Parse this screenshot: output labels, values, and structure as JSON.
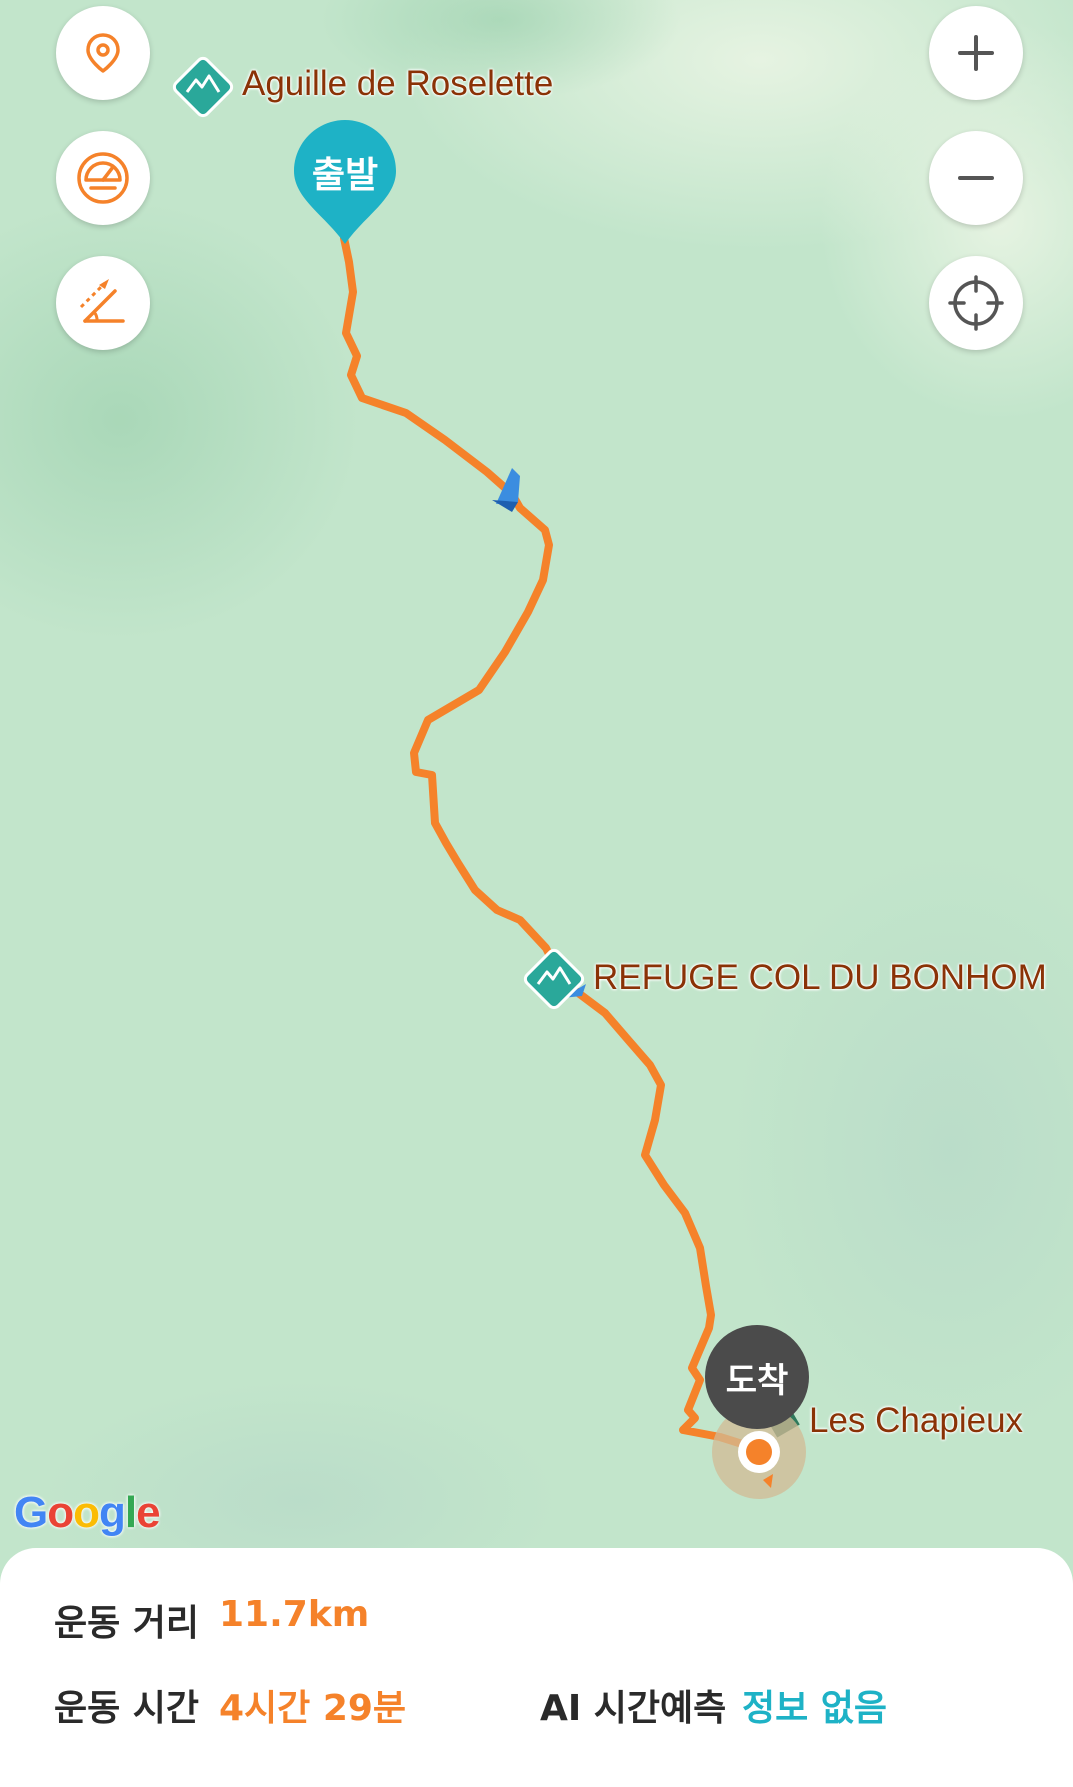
{
  "map": {
    "pois": [
      {
        "name": "Aguille de Roselette"
      },
      {
        "name": "REFUGE COL DU BONHOM"
      },
      {
        "name": "Les Chapieux"
      }
    ],
    "start_marker": "출발",
    "end_marker": "도착",
    "attribution": [
      "G",
      "o",
      "o",
      "g",
      "l",
      "e"
    ],
    "route_color": "#f5822a",
    "poi_color": "#2aa89a",
    "start_color": "#1eb2c6"
  },
  "controls": {
    "left": [
      "location-pin-icon",
      "speedometer-icon",
      "slope-icon"
    ],
    "right": [
      "plus-icon",
      "minus-icon",
      "crosshair-icon"
    ]
  },
  "stats": {
    "distance_label": "운동 거리",
    "distance_value": "11.7km",
    "time_label": "운동 시간",
    "time_value": "4시간 29분",
    "ai_label": "AI 시간예측",
    "ai_value": "정보 없음"
  },
  "colors": {
    "accent": "#f5822a",
    "teal": "#1eb2c6"
  }
}
